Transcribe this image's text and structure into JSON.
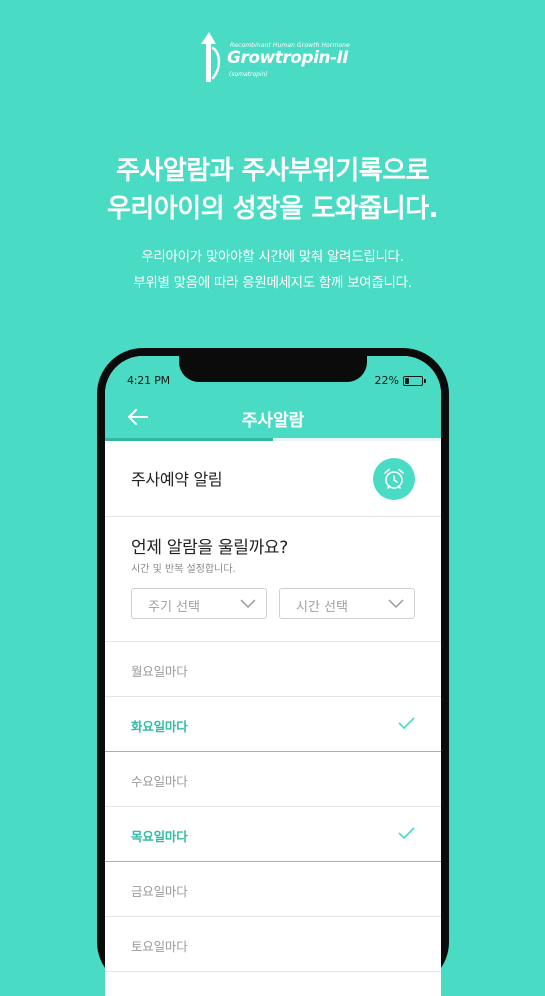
{
  "logo": {
    "tagline": "Recombinant Human Growth Hormone",
    "brand": "Growtropin-II",
    "sub": "(somatropin)"
  },
  "promo": {
    "headline_line1": "주사알람과 주사부위기록으로",
    "headline_line2": "우리아이의 성장을 도와줍니다.",
    "desc_line1": "우리아이가 맞아야할 시간에 맞춰 알려드립니다.",
    "desc_line2": "부위별 맞음에 따라 응원메세지도 함께 보여줍니다."
  },
  "status": {
    "time": "4:21 PM",
    "battery": "22%",
    "battery_level": 0.22
  },
  "appbar": {
    "title": "주사알람",
    "progress": 0.5
  },
  "alarm_row": {
    "label": "주사예약 알림"
  },
  "schedule": {
    "question": "언제 알람을 울릴까요?",
    "hint": "시간 및 반복 설정합니다.",
    "cycle_select": "주기 선택",
    "time_select": "시간 선택"
  },
  "days": [
    {
      "label": "월요일마다",
      "selected": false
    },
    {
      "label": "화요일마다",
      "selected": true
    },
    {
      "label": "수요일마다",
      "selected": false
    },
    {
      "label": "목요일마다",
      "selected": true
    },
    {
      "label": "금요일마다",
      "selected": false
    },
    {
      "label": "토요일마다",
      "selected": false
    }
  ],
  "colors": {
    "accent": "#4adbc4",
    "accent_text": "#34bba6",
    "frame": "#0b0b0b"
  }
}
